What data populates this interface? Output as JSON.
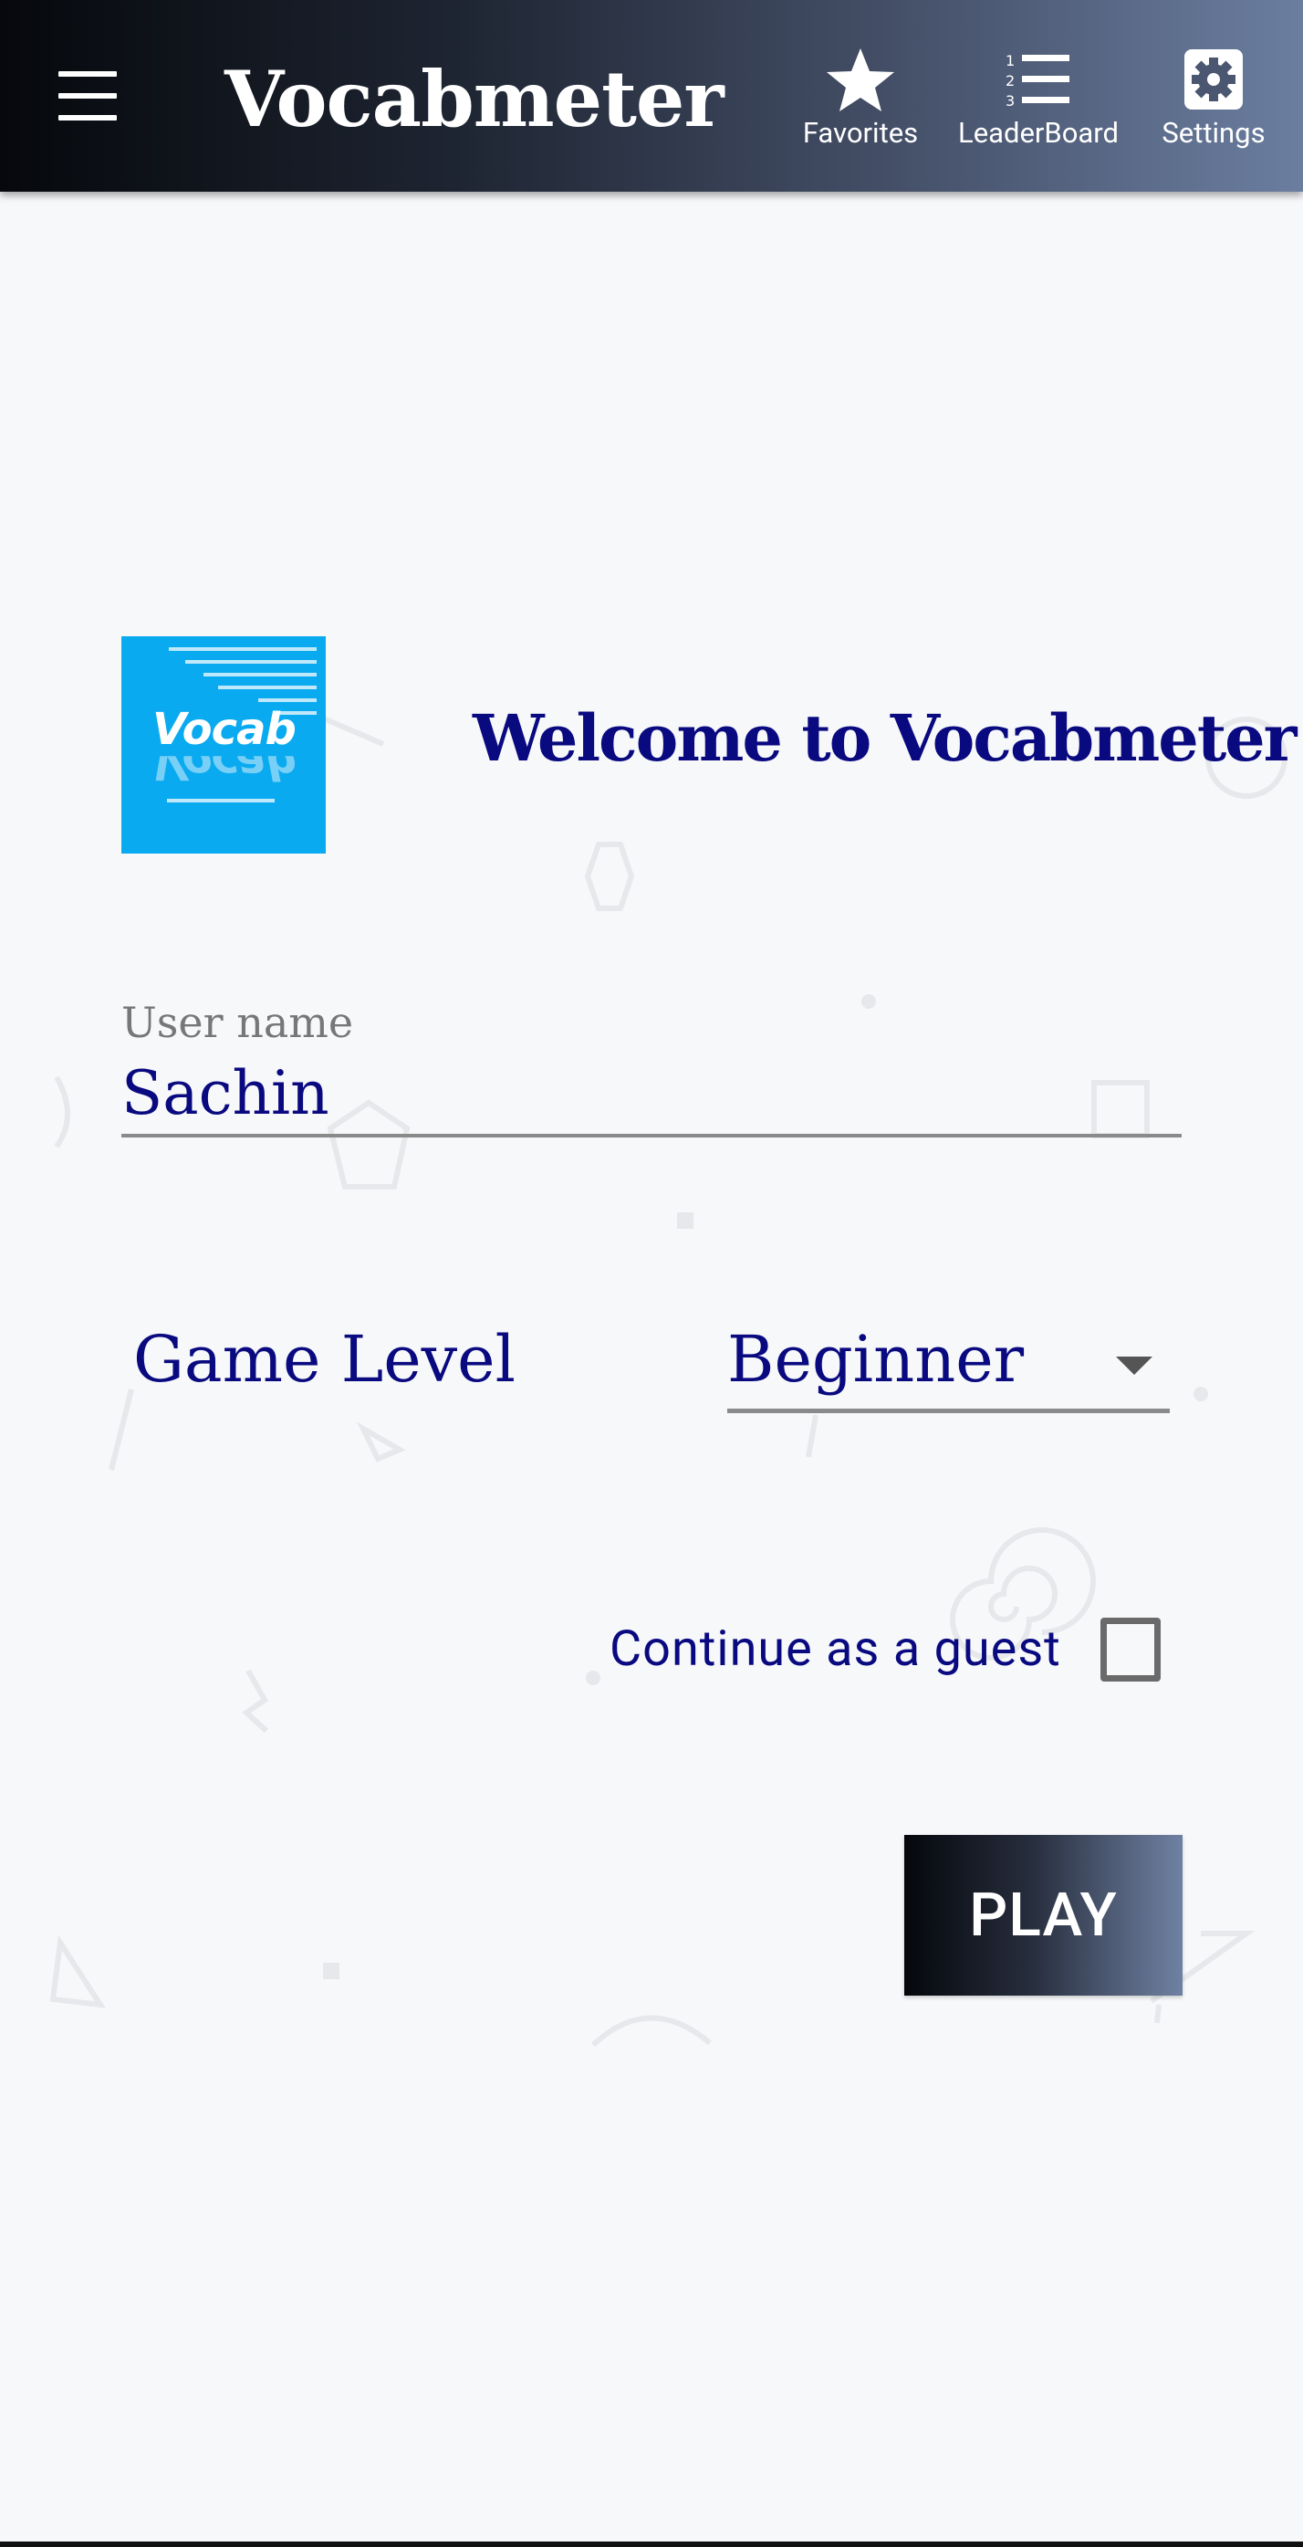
{
  "appbar": {
    "title": "Vocabmeter",
    "actions": [
      {
        "label": "Favorites",
        "icon": "star-icon"
      },
      {
        "label": "LeaderBoard",
        "icon": "ordered-list-icon"
      },
      {
        "label": "Settings",
        "icon": "gear-icon"
      }
    ]
  },
  "logo": {
    "text": "Vocab"
  },
  "welcome": "Welcome to Vocabmeter",
  "form": {
    "username_label": "User name",
    "username_value": "Sachin",
    "level_label": "Game Level",
    "level_value": "Beginner",
    "guest_label": "Continue as a guest",
    "guest_checked": false,
    "play_label": "PLAY"
  },
  "colors": {
    "text_primary": "#0a0a80",
    "logo_bg": "#0aaaf0",
    "appbar_gradient": [
      "#06080c",
      "#6b7ea0"
    ]
  }
}
